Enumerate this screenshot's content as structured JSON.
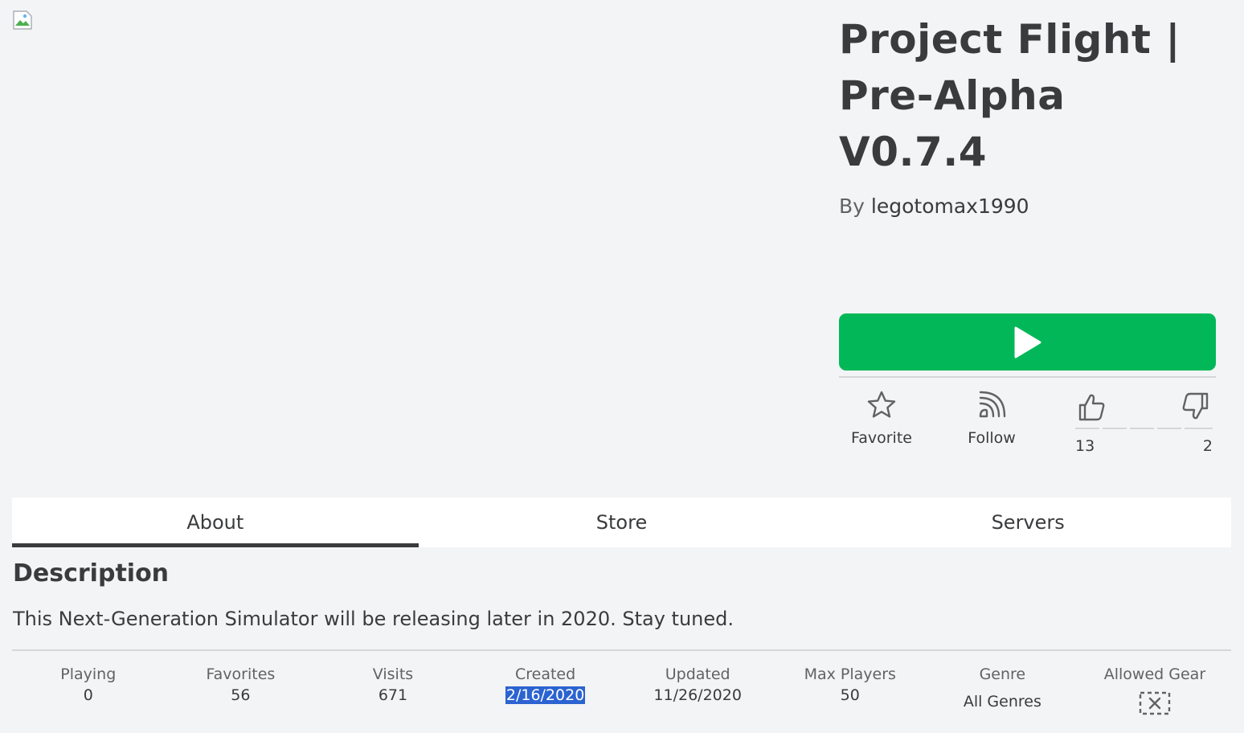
{
  "game": {
    "title": "Project Flight | Pre-Alpha V0.7.4",
    "by_label": "By",
    "creator": "legotomax1990"
  },
  "actions": {
    "favorite_label": "Favorite",
    "follow_label": "Follow",
    "upvotes": "13",
    "downvotes": "2"
  },
  "tabs": [
    {
      "label": "About",
      "active": true
    },
    {
      "label": "Store",
      "active": false
    },
    {
      "label": "Servers",
      "active": false
    }
  ],
  "description": {
    "heading": "Description",
    "text": "This Next-Generation Simulator will be releasing later in 2020. Stay tuned."
  },
  "stats": [
    {
      "label": "Playing",
      "value": "0"
    },
    {
      "label": "Favorites",
      "value": "56"
    },
    {
      "label": "Visits",
      "value": "671"
    },
    {
      "label": "Created",
      "value": "2/16/2020"
    },
    {
      "label": "Updated",
      "value": "11/26/2020"
    },
    {
      "label": "Max Players",
      "value": "50"
    },
    {
      "label": "Genre",
      "value": "All Genres"
    },
    {
      "label": "Allowed Gear",
      "value": ""
    }
  ],
  "colors": {
    "play_button": "#02b757",
    "text": "#393b3d",
    "selection": "#2b63d1"
  },
  "icons": [
    "broken-image-icon",
    "play-icon",
    "star-icon",
    "follow-icon",
    "thumbs-up-icon",
    "thumbs-down-icon",
    "no-gear-icon"
  ]
}
